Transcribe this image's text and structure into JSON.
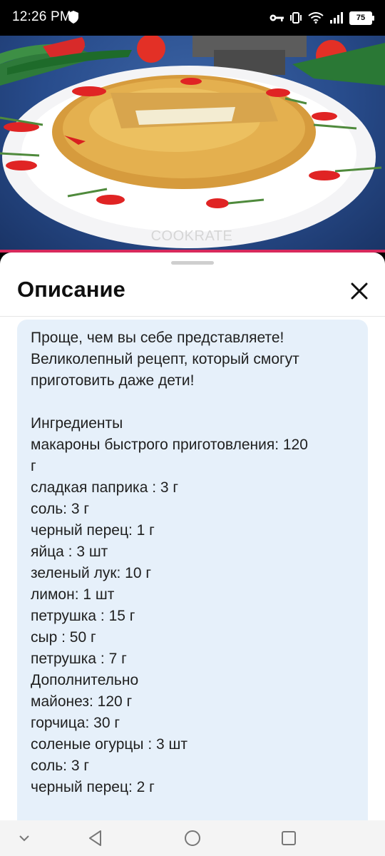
{
  "status_bar": {
    "time": "12:26 PM",
    "battery_level": "75",
    "icons": [
      "shield-icon",
      "key-icon",
      "vibrate-icon",
      "wifi-icon",
      "signal-icon",
      "battery-icon"
    ]
  },
  "video": {
    "watermark": "COOKRATE",
    "progress_color": "#d8295c"
  },
  "sheet": {
    "title": "Описание",
    "close_icon": "close-icon",
    "description_lines": [
      "Проще, чем вы себе представляете!",
      "Великолепный рецепт, который смогут",
      "приготовить даже дети!",
      "",
      "Ингредиенты",
      "макароны быстрого приготовления: 120",
      "г",
      "сладкая паприка : 3 г",
      "соль: 3 г",
      "черный перец: 1 г",
      "яйца : 3 шт",
      "зеленый лук: 10 г",
      "лимон: 1 шт",
      "петрушка : 15 г",
      "сыр : 50 г",
      "петрушка : 7 г",
      "Дополнительно",
      "майонез: 120 г",
      "горчица: 30 г",
      "соленые огурцы : 3 шт",
      "соль: 3 г",
      "черный перец: 2 г"
    ],
    "box_color": "#e6f0fa"
  },
  "nav_bar": {
    "items": [
      "chevron-down-icon",
      "back-icon",
      "home-icon",
      "recents-icon"
    ]
  }
}
